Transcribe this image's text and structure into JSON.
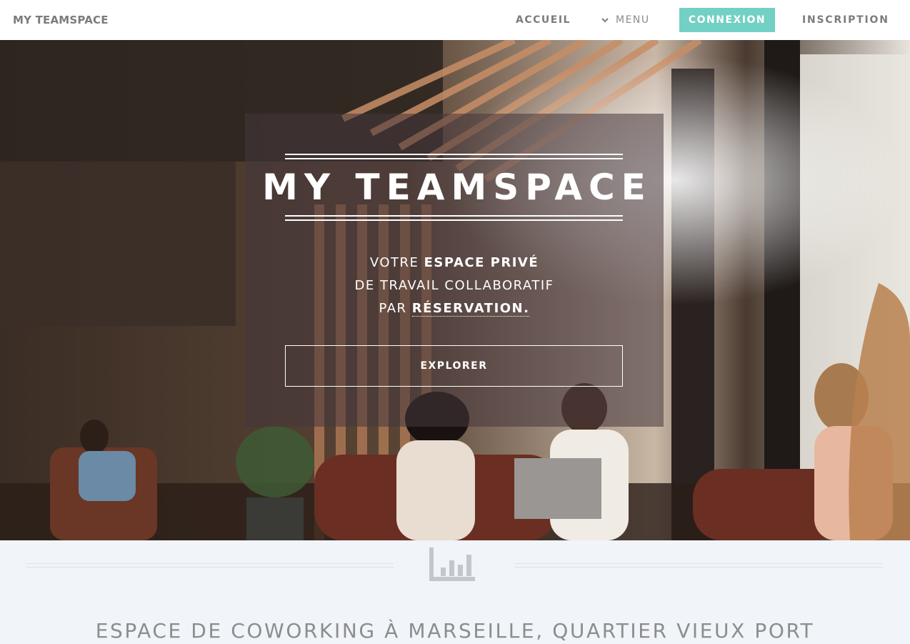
{
  "nav": {
    "brand": "MY TEAMSPACE",
    "accueil": "ACCUEIL",
    "menu": "MENU",
    "connexion": "CONNEXION",
    "inscription": "INSCRIPTION"
  },
  "hero": {
    "title": "MY TEAMSPACE",
    "subtitle_line1_prefix": "VOTRE ",
    "subtitle_line1_bold": "ESPACE PRIVÉ",
    "subtitle_line2": "DE TRAVAIL COLLABORATIF",
    "subtitle_line3_prefix": "PAR ",
    "subtitle_line3_link": "RÉSERVATION.",
    "explore_label": "EXPLORER"
  },
  "section": {
    "icon": "bar-chart-icon",
    "title": "ESPACE DE COWORKING À MARSEILLE, QUARTIER VIEUX PORT"
  },
  "colors": {
    "accent": "#72d0c4",
    "nav_text": "#7a7c7e",
    "section_bg": "#f1f4f8"
  }
}
